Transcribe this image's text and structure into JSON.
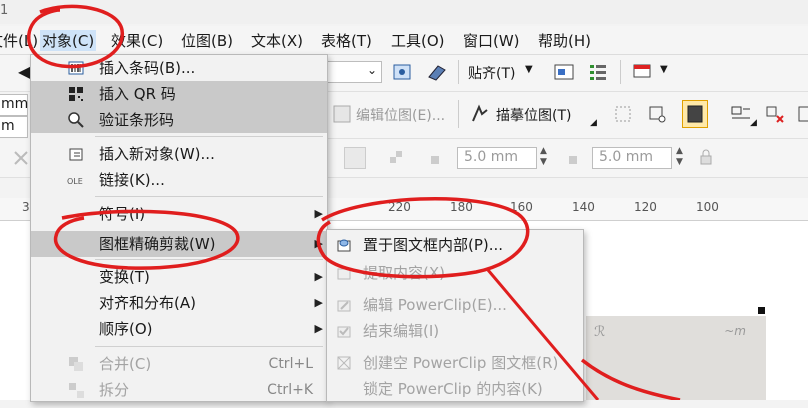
{
  "title_fragment": "1",
  "menubar": {
    "items": [
      {
        "label": "文件(L)"
      },
      {
        "label": "对象(C)"
      },
      {
        "label": "效果(C)"
      },
      {
        "label": "位图(B)"
      },
      {
        "label": "文本(X)"
      },
      {
        "label": "表格(T)"
      },
      {
        "label": "工具(O)"
      },
      {
        "label": "窗口(W)"
      },
      {
        "label": "帮助(H)"
      }
    ]
  },
  "toolbar1": {
    "snap_label": "贴齐(T)",
    "left_unit_1": "mm",
    "left_unit_2": "m"
  },
  "toolbar2": {
    "edit_bitmap": "编辑位图(E)...",
    "trace_bitmap": "描摹位图(T)"
  },
  "toolbar3": {
    "field1": "5.0 mm",
    "field2": "5.0 mm"
  },
  "ruler": {
    "ticks": [
      "3",
      "220",
      "180",
      "160",
      "140",
      "120",
      "100"
    ]
  },
  "object_menu": {
    "items": [
      {
        "label": "插入条码(B)...",
        "icon": "barcode-icon",
        "state": "normal"
      },
      {
        "label": "插入 QR 码",
        "icon": "qr-code-icon",
        "state": "highlight"
      },
      {
        "label": "验证条形码",
        "icon": "magnifier-icon",
        "state": "highlight"
      },
      {
        "label": "插入新对象(W)...",
        "icon": "insert-object-icon",
        "state": "normal"
      },
      {
        "label": "链接(K)...",
        "icon": "ole-icon",
        "state": "normal"
      },
      {
        "label": "符号(I)",
        "icon": "",
        "state": "normal",
        "submenu": true
      },
      {
        "label": "图框精确剪裁(W)",
        "icon": "",
        "state": "active",
        "submenu": true
      },
      {
        "label": "变换(T)",
        "icon": "",
        "state": "normal",
        "submenu": true
      },
      {
        "label": "对齐和分布(A)",
        "icon": "",
        "state": "normal",
        "submenu": true
      },
      {
        "label": "顺序(O)",
        "icon": "",
        "state": "normal",
        "submenu": true
      },
      {
        "label": "合并(C)",
        "icon": "combine-icon",
        "state": "disabled",
        "shortcut": "Ctrl+L"
      },
      {
        "label": "拆分",
        "icon": "split-icon",
        "state": "disabled",
        "shortcut": "Ctrl+K"
      }
    ]
  },
  "powerclip_menu": {
    "items": [
      {
        "label": "置于图文框内部(P)...",
        "state": "normal"
      },
      {
        "label": "提取内容(X)",
        "state": "disabled"
      },
      {
        "label": "编辑 PowerClip(E)...",
        "state": "disabled"
      },
      {
        "label": "结束编辑(I)",
        "state": "disabled"
      },
      {
        "label": "创建空 PowerClip 图文框(R)",
        "state": "disabled"
      },
      {
        "label": "锁定 PowerClip 的内容(K)",
        "state": "disabled"
      }
    ]
  },
  "colors": {
    "annotation_red": "#e01e1e",
    "highlight_gray": "#c9c9c9",
    "menu_bg": "#f2f2f2"
  }
}
